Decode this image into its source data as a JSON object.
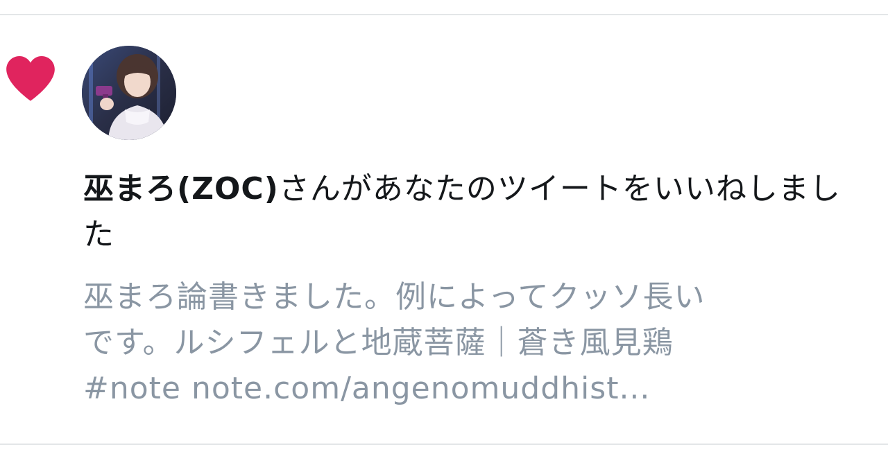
{
  "notification": {
    "actor_name": "巫まろ(ZOC)",
    "action_text": "さんがあなたのツイートをいいねしました"
  },
  "tweet_preview": {
    "line1": "巫まろ論書きました。例によってクッソ長い",
    "line2": "です。ルシフェルと地蔵菩薩｜蒼き風見鶏",
    "line3": "#note note.com/angenomuddhist..."
  },
  "colors": {
    "heart": "#e0245e",
    "primary_text": "#14171a",
    "secondary_text": "#8a96a3",
    "divider": "#e3e6e8"
  },
  "icons": {
    "like": "heart-icon",
    "avatar": "user-avatar"
  }
}
